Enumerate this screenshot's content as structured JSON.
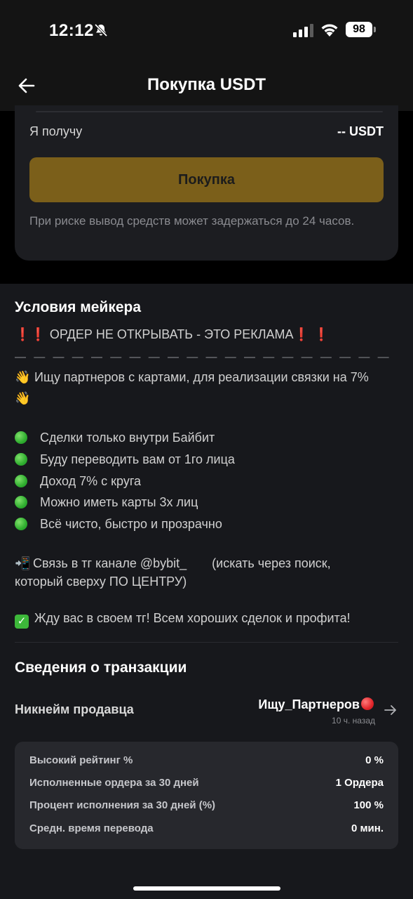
{
  "status_bar": {
    "time": "12:12",
    "battery": "98"
  },
  "header": {
    "title": "Покупка USDT"
  },
  "order_card": {
    "receive_label": "Я получу",
    "receive_value": "-- USDT",
    "buy_button": "Покупка",
    "risk_note": "При риске вывод средств может задержаться до 24 часов."
  },
  "maker_terms": {
    "title": "Условия мейкера",
    "warning_text": " ОРДЕР НЕ ОТКРЫВАТЬ - ЭТО РЕКЛАМА",
    "exclamation": "❗",
    "separator": "— — — — — — — — — — — — — — — — — — — —",
    "partners_line": "Ищу партнеров с картами, для реализации связки на 7%",
    "wave_emoji": "👋",
    "bullets": [
      "Сделки только внутри Байбит",
      "Буду переводить вам от 1го лица",
      "Доход 7% с круга",
      "Можно иметь карты 3х лиц",
      "Всё чисто, быстро и прозрачно"
    ],
    "contact_line_1a": "Связь в тг канале @bybit_",
    "contact_line_1b": "(искать через поиск,",
    "contact_line_2": "который сверху ПО ЦЕНТРУ)",
    "phone_emoji": "📲",
    "closing_line": "Жду вас в своем тг! Всем хороших сделок и профита!",
    "check_mark": "✓"
  },
  "transaction": {
    "title": "Сведения о транзакции",
    "seller_label": "Никнейм продавца",
    "seller_name": "Ищу_Партнеров",
    "seller_time": "10 ч. назад"
  },
  "stats": [
    {
      "label": "Высокий рейтинг %",
      "value": "0 %"
    },
    {
      "label": "Исполненные ордера за 30 дней",
      "value": "1 Ордера"
    },
    {
      "label": "Процент исполнения за 30 дней (%)",
      "value": "100 %"
    },
    {
      "label": "Средн. время перевода",
      "value": "0 мин."
    }
  ],
  "colors": {
    "accent": "#7b5f1a",
    "background": "#17181c",
    "warning": "#e8312a",
    "success": "#3db83a"
  },
  "icons": [
    "bell-off-icon",
    "signal-icon",
    "wifi-icon",
    "battery-icon",
    "back-arrow-icon",
    "chevron-right-icon"
  ]
}
